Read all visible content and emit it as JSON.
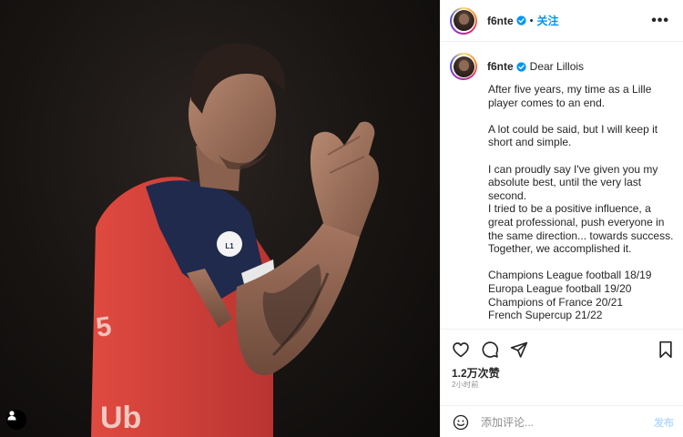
{
  "photo": {
    "alt_subject": "football player applauding",
    "shirt_patch": "LIGUE 1",
    "shirt_sponsor": "Uber Eats"
  },
  "header": {
    "username": "f6nte",
    "separator": "•",
    "follow_label": "关注",
    "more_label": "•••"
  },
  "caption": {
    "username": "f6nte",
    "intro": "Dear Lillois",
    "lines": [
      "After five years, my time as a Lille player comes to an end.",
      "",
      "A lot could be said, but I will keep it short and simple.",
      "",
      "I can proudly say I've given you my absolute best, until the very last second.",
      "I tried to be a positive influence, a great professional, push everyone in the same direction... towards success.",
      "Together, we accomplished it.",
      "",
      "Champions League football 18/19",
      "Europa League football 19/20",
      "Champions of France 20/21",
      "French Supercup 21/22"
    ]
  },
  "actions": {
    "likes": "1.2万次赞",
    "time": "2小时前"
  },
  "comment": {
    "placeholder": "添加评论...",
    "post_label": "发布"
  },
  "colors": {
    "accent": "#0095f6",
    "verified": "#0095f6",
    "shirt_red": "#d9443d",
    "shirt_navy": "#1f2a4d"
  }
}
